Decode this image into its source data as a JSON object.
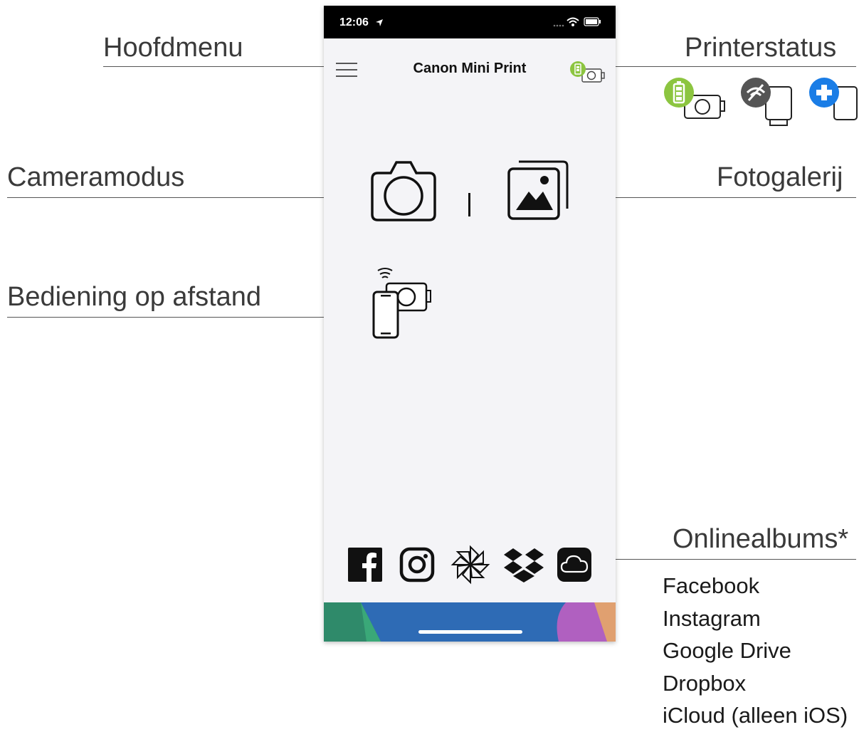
{
  "callouts": {
    "main_menu": "Hoofdmenu",
    "printer_status": "Printerstatus",
    "camera_mode": "Cameramodus",
    "photo_gallery": "Fotogalerij",
    "remote_control": "Bediening op afstand",
    "online_albums": "Onlinealbums*"
  },
  "online_albums_list": [
    "Facebook",
    "Instagram",
    "Google Drive",
    "Dropbox",
    "iCloud (alleen iOS)"
  ],
  "phone": {
    "status_time": "12:06",
    "app_title": "Canon Mini Print"
  },
  "icons": {
    "menu": "hamburger-icon",
    "printer_status": "printer-battery-icon",
    "camera": "camera-icon",
    "gallery": "photo-gallery-icon",
    "remote": "remote-camera-icon",
    "album_sources": [
      "facebook-icon",
      "instagram-icon",
      "google-drive-icon",
      "dropbox-icon",
      "icloud-icon"
    ]
  },
  "colors": {
    "battery_green": "#8cc540",
    "disconnected_gray": "#555555",
    "connect_blue": "#1a7de6"
  }
}
